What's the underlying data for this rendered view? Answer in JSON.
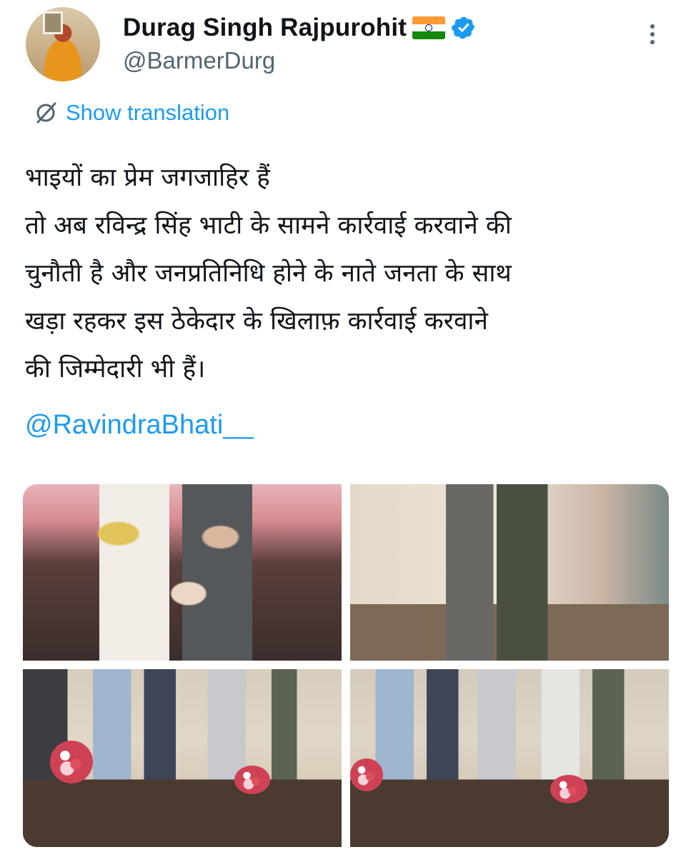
{
  "author": {
    "name": "Durag Singh Rajpurohit",
    "handle": "@BarmerDurg",
    "flag_icon": "india-flag-icon",
    "verified_color": "#1d9bf0"
  },
  "translate": {
    "label": "Show translation"
  },
  "tweet": {
    "lines": [
      "भाइयों का प्रेम जगजाहिर हैं",
      "तो अब रविन्द्र सिंह भाटी के सामने कार्रवाई करवाने की",
      "चुनौती है और जनप्रतिनिधि होने के नाते जनता के साथ",
      "खड़ा रहकर इस ठेकेदार के खिलाफ़ कार्रवाई करवाने",
      "की जिम्मेदारी भी हैं।"
    ],
    "mention": "@RavindraBhati__"
  },
  "colors": {
    "link": "#1d9bf0",
    "text": "#0f1419",
    "secondary": "#536471"
  }
}
